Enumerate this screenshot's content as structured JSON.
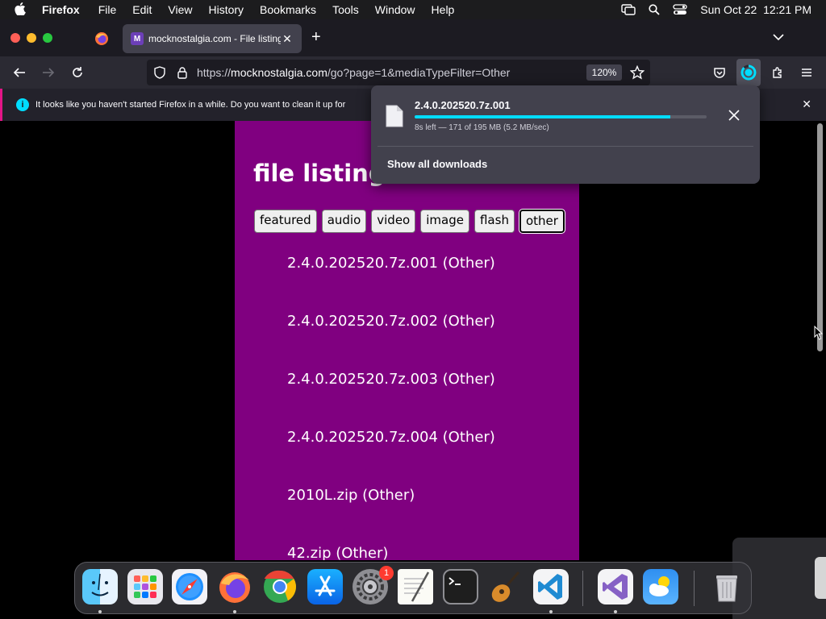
{
  "menubar": {
    "app_name": "Firefox",
    "items": [
      "File",
      "Edit",
      "View",
      "History",
      "Bookmarks",
      "Tools",
      "Window",
      "Help"
    ],
    "datetime": "Sun Oct 22  12:21 PM"
  },
  "tabs": {
    "active_title": "mocknostalgia.com - File listing",
    "favicon_letter": "M"
  },
  "navbar": {
    "url_prefix": "https://",
    "url_host": "mocknostalgia.com",
    "url_path": "/go?page=1&mediaTypeFilter=Other",
    "zoom": "120%"
  },
  "notification": {
    "text": "It looks like you haven't started Firefox in a while. Do you want to clean it up for"
  },
  "page": {
    "heading": "file listing",
    "filters": [
      "featured",
      "audio",
      "video",
      "image",
      "flash",
      "other"
    ],
    "active_filter": "other",
    "files": [
      "2.4.0.202520.7z.001 (Other)",
      "2.4.0.202520.7z.002 (Other)",
      "2.4.0.202520.7z.003 (Other)",
      "2.4.0.202520.7z.004 (Other)",
      "2010L.zip (Other)",
      "42.zip (Other)"
    ]
  },
  "downloads": {
    "filename": "2.4.0.202520.7z.001",
    "progress_fraction": 0.877,
    "status": "8s left — 171 of 195 MB (5.2 MB/sec)",
    "show_all_label": "Show all downloads"
  },
  "dock": {
    "apps": [
      "Finder",
      "Launchpad",
      "Safari",
      "Firefox",
      "Chrome",
      "App Store",
      "System Settings",
      "TextEdit",
      "Terminal",
      "GarageBand",
      "Visual Studio Code",
      "Visual Studio",
      "Weather",
      "Trash"
    ],
    "settings_badge": "1"
  },
  "colors": {
    "card_bg": "#800080",
    "accent": "#00ddff",
    "notification_stripe": "#e31587"
  }
}
